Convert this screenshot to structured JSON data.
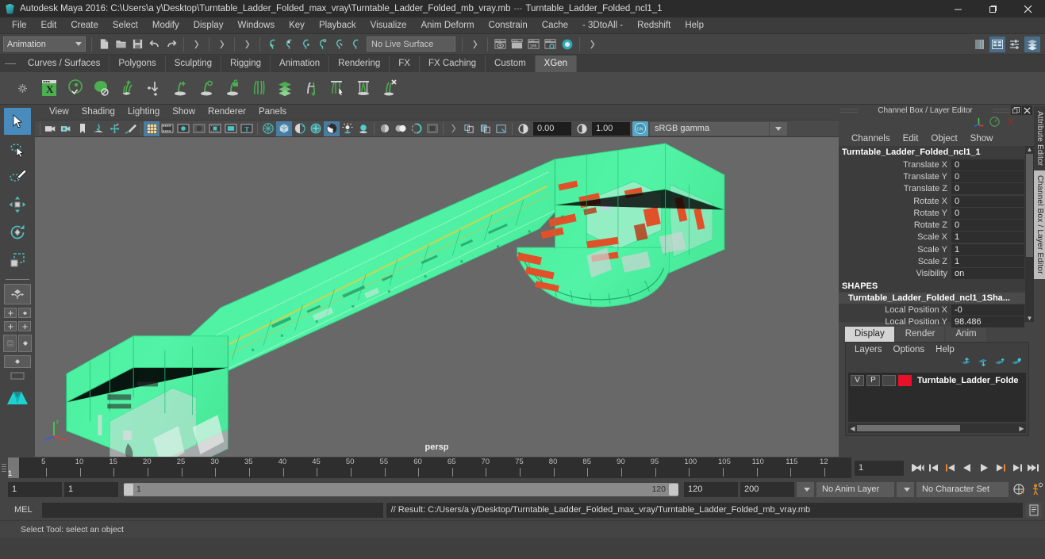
{
  "window": {
    "app_title": "Autodesk Maya 2016: C:\\Users\\a y\\Desktop\\Turntable_Ladder_Folded_max_vray\\Turntable_Ladder_Folded_mb_vray.mb",
    "separator": "---",
    "selected_object": "Turntable_Ladder_Folded_ncl1_1",
    "minimize": "—",
    "restore": "❐",
    "close": "✕"
  },
  "menubar": {
    "items": [
      "File",
      "Edit",
      "Create",
      "Select",
      "Modify",
      "Display",
      "Windows",
      "Key",
      "Playback",
      "Visualize",
      "Anim Deform",
      "Constrain",
      "Cache",
      "- 3DtoAll -",
      "Redshift",
      "Help"
    ]
  },
  "statusline": {
    "mode": "Animation",
    "live_surface": "No Live Surface",
    "icons": [
      "new-scene-icon",
      "open-scene-icon",
      "save-scene-icon",
      "undo-icon",
      "redo-icon",
      "select-hierarchy-icon",
      "select-object-icon",
      "select-component-icon",
      "snap-grid-icon",
      "snap-curve-icon",
      "snap-point-icon",
      "snap-projected-icon",
      "snap-view-plane-icon",
      "make-live-icon",
      "render-current-frame-icon",
      "render-sequence-icon",
      "ipr-render-icon",
      "render-settings-icon",
      "hypershade-icon"
    ],
    "right_icons": [
      "show-hide-editors-icon",
      "channel-box-toggle-icon",
      "attribute-editor-toggle-icon",
      "tool-settings-toggle-icon"
    ]
  },
  "shelf": {
    "tabs": [
      "Curves / Surfaces",
      "Polygons",
      "Sculpting",
      "Rigging",
      "Animation",
      "Rendering",
      "FX",
      "FX Caching",
      "Custom",
      "XGen"
    ],
    "active_tab": "XGen",
    "icons": [
      "xgen-editor-icon",
      "xgen-preview-icon",
      "xgen-solid-icon",
      "xgen-add-guides-icon",
      "xgen-place-icon",
      "xgen-add-grooming-icon",
      "xgen-sphere-guide-icon",
      "xgen-lock-icon",
      "xgen-comb-icon",
      "xgen-layers-icon",
      "xgen-length-icon",
      "xgen-select-icon",
      "xgen-clump-icon",
      "xgen-delete-icon"
    ]
  },
  "toolbox": {
    "tools": [
      "select-tool",
      "lasso-select-tool",
      "paint-select-tool",
      "move-tool",
      "rotate-tool",
      "scale-tool"
    ],
    "active_tool": "select-tool",
    "layouts": [
      "single-perspective-layout",
      "four-view-layout",
      "two-pane-layout",
      "outliner-persp-layout",
      "hypershade-persp-layout"
    ]
  },
  "viewport": {
    "menus": [
      "View",
      "Shading",
      "Lighting",
      "Show",
      "Renderer",
      "Panels"
    ],
    "camera_label": "persp",
    "exposure": "0.00",
    "gamma_value": "1.00",
    "color_management": "sRGB gamma",
    "toolbar_icons": [
      "select-camera-icon",
      "camera-attributes-icon",
      "bookmark-icon",
      "image-plane-icon",
      "two-d-pan-zoom-icon",
      "grease-pencil-icon",
      "grid-icon",
      "film-gate-icon",
      "resolution-gate-icon",
      "gate-mask-icon",
      "film-origin-icon",
      "safe-action-icon",
      "title-safe-icon",
      "wireframe-icon",
      "smooth-shade-all-icon",
      "flat-shade-icon",
      "shaded-wireframe-icon",
      "textured-icon",
      "lighting-icon",
      "shadows-icon",
      "screen-space-ao-icon",
      "motion-blur-icon",
      "multisample-icon",
      "depth-of-field-icon",
      "isolate-select-icon",
      "xray-icon",
      "xray-joints-icon",
      "xray-active-components-icon",
      "exposure-icon",
      "gamma-icon",
      "color-management-toggle-icon"
    ],
    "model_color_main": "#4cf0a0",
    "model_color_accent": "#e0512a",
    "background_color": "#686868"
  },
  "channel_box": {
    "panel_title": "Channel Box / Layer Editor",
    "menus": [
      "Channels",
      "Edit",
      "Object",
      "Show"
    ],
    "object_name": "Turntable_Ladder_Folded_ncl1_1",
    "attributes": [
      {
        "label": "Translate X",
        "value": "0"
      },
      {
        "label": "Translate Y",
        "value": "0"
      },
      {
        "label": "Translate Z",
        "value": "0"
      },
      {
        "label": "Rotate X",
        "value": "0"
      },
      {
        "label": "Rotate Y",
        "value": "0"
      },
      {
        "label": "Rotate Z",
        "value": "0"
      },
      {
        "label": "Scale X",
        "value": "1"
      },
      {
        "label": "Scale Y",
        "value": "1"
      },
      {
        "label": "Scale Z",
        "value": "1"
      },
      {
        "label": "Visibility",
        "value": "on"
      }
    ],
    "section_header": "SHAPES",
    "shape_name": "Turntable_Ladder_Folded_ncl1_1Sha...",
    "shape_attributes": [
      {
        "label": "Local Position X",
        "value": "-0"
      },
      {
        "label": "Local Position Y",
        "value": "98.486"
      }
    ]
  },
  "vertical_tabs": {
    "items": [
      "Attribute Editor",
      "Channel Box / Layer Editor"
    ],
    "active": "Channel Box / Layer Editor"
  },
  "layer_editor": {
    "tabs": [
      "Display",
      "Render",
      "Anim"
    ],
    "active_tab": "Display",
    "menus": [
      "Layers",
      "Options",
      "Help"
    ],
    "action_icons": [
      "move-layer-up-icon",
      "move-layer-down-icon",
      "new-layer-icon",
      "new-layer-from-selected-icon"
    ],
    "layers": [
      {
        "visibility": "V",
        "playback": "P",
        "shading": "",
        "color": "#e8102a",
        "name": "Turntable_Ladder_Folde"
      }
    ]
  },
  "timeline": {
    "start_frame": "1",
    "current_frame": "1",
    "ticks": [
      {
        "label": "5",
        "frame": 5
      },
      {
        "label": "10",
        "frame": 10
      },
      {
        "label": "15",
        "frame": 15
      },
      {
        "label": "20",
        "frame": 20
      },
      {
        "label": "25",
        "frame": 25
      },
      {
        "label": "30",
        "frame": 30
      },
      {
        "label": "35",
        "frame": 35
      },
      {
        "label": "40",
        "frame": 40
      },
      {
        "label": "45",
        "frame": 45
      },
      {
        "label": "50",
        "frame": 50
      },
      {
        "label": "55",
        "frame": 55
      },
      {
        "label": "60",
        "frame": 60
      },
      {
        "label": "65",
        "frame": 65
      },
      {
        "label": "70",
        "frame": 70
      },
      {
        "label": "75",
        "frame": 75
      },
      {
        "label": "80",
        "frame": 80
      },
      {
        "label": "85",
        "frame": 85
      },
      {
        "label": "90",
        "frame": 90
      },
      {
        "label": "95",
        "frame": 95
      },
      {
        "label": "100",
        "frame": 100
      },
      {
        "label": "105",
        "frame": 105
      },
      {
        "label": "110",
        "frame": 110
      },
      {
        "label": "115",
        "frame": 115
      },
      {
        "label": "12",
        "frame": 120
      }
    ],
    "frame_field": "1",
    "playback_buttons": [
      "go-to-start-icon",
      "step-back-keyframe-icon",
      "step-back-frame-icon",
      "play-backwards-icon",
      "play-forwards-icon",
      "step-forward-frame-icon",
      "step-forward-keyframe-icon",
      "go-to-end-icon"
    ]
  },
  "range_slider": {
    "anim_start": "1",
    "range_start": "1",
    "bar_start_label": "1",
    "bar_end_label": "120",
    "range_end": "120",
    "anim_end": "200",
    "anim_layer": "No Anim Layer",
    "character_set": "No Character Set",
    "right_icons": [
      "auto-key-icon",
      "animation-preferences-icon"
    ]
  },
  "command_line": {
    "language_label": "MEL",
    "input_value": "",
    "result_text": "// Result: C:/Users/a y/Desktop/Turntable_Ladder_Folded_max_vray/Turntable_Ladder_Folded_mb_vray.mb",
    "script_editor_icon": "script-editor-icon"
  },
  "status_bar": {
    "help_text": "Select Tool: select an object"
  }
}
